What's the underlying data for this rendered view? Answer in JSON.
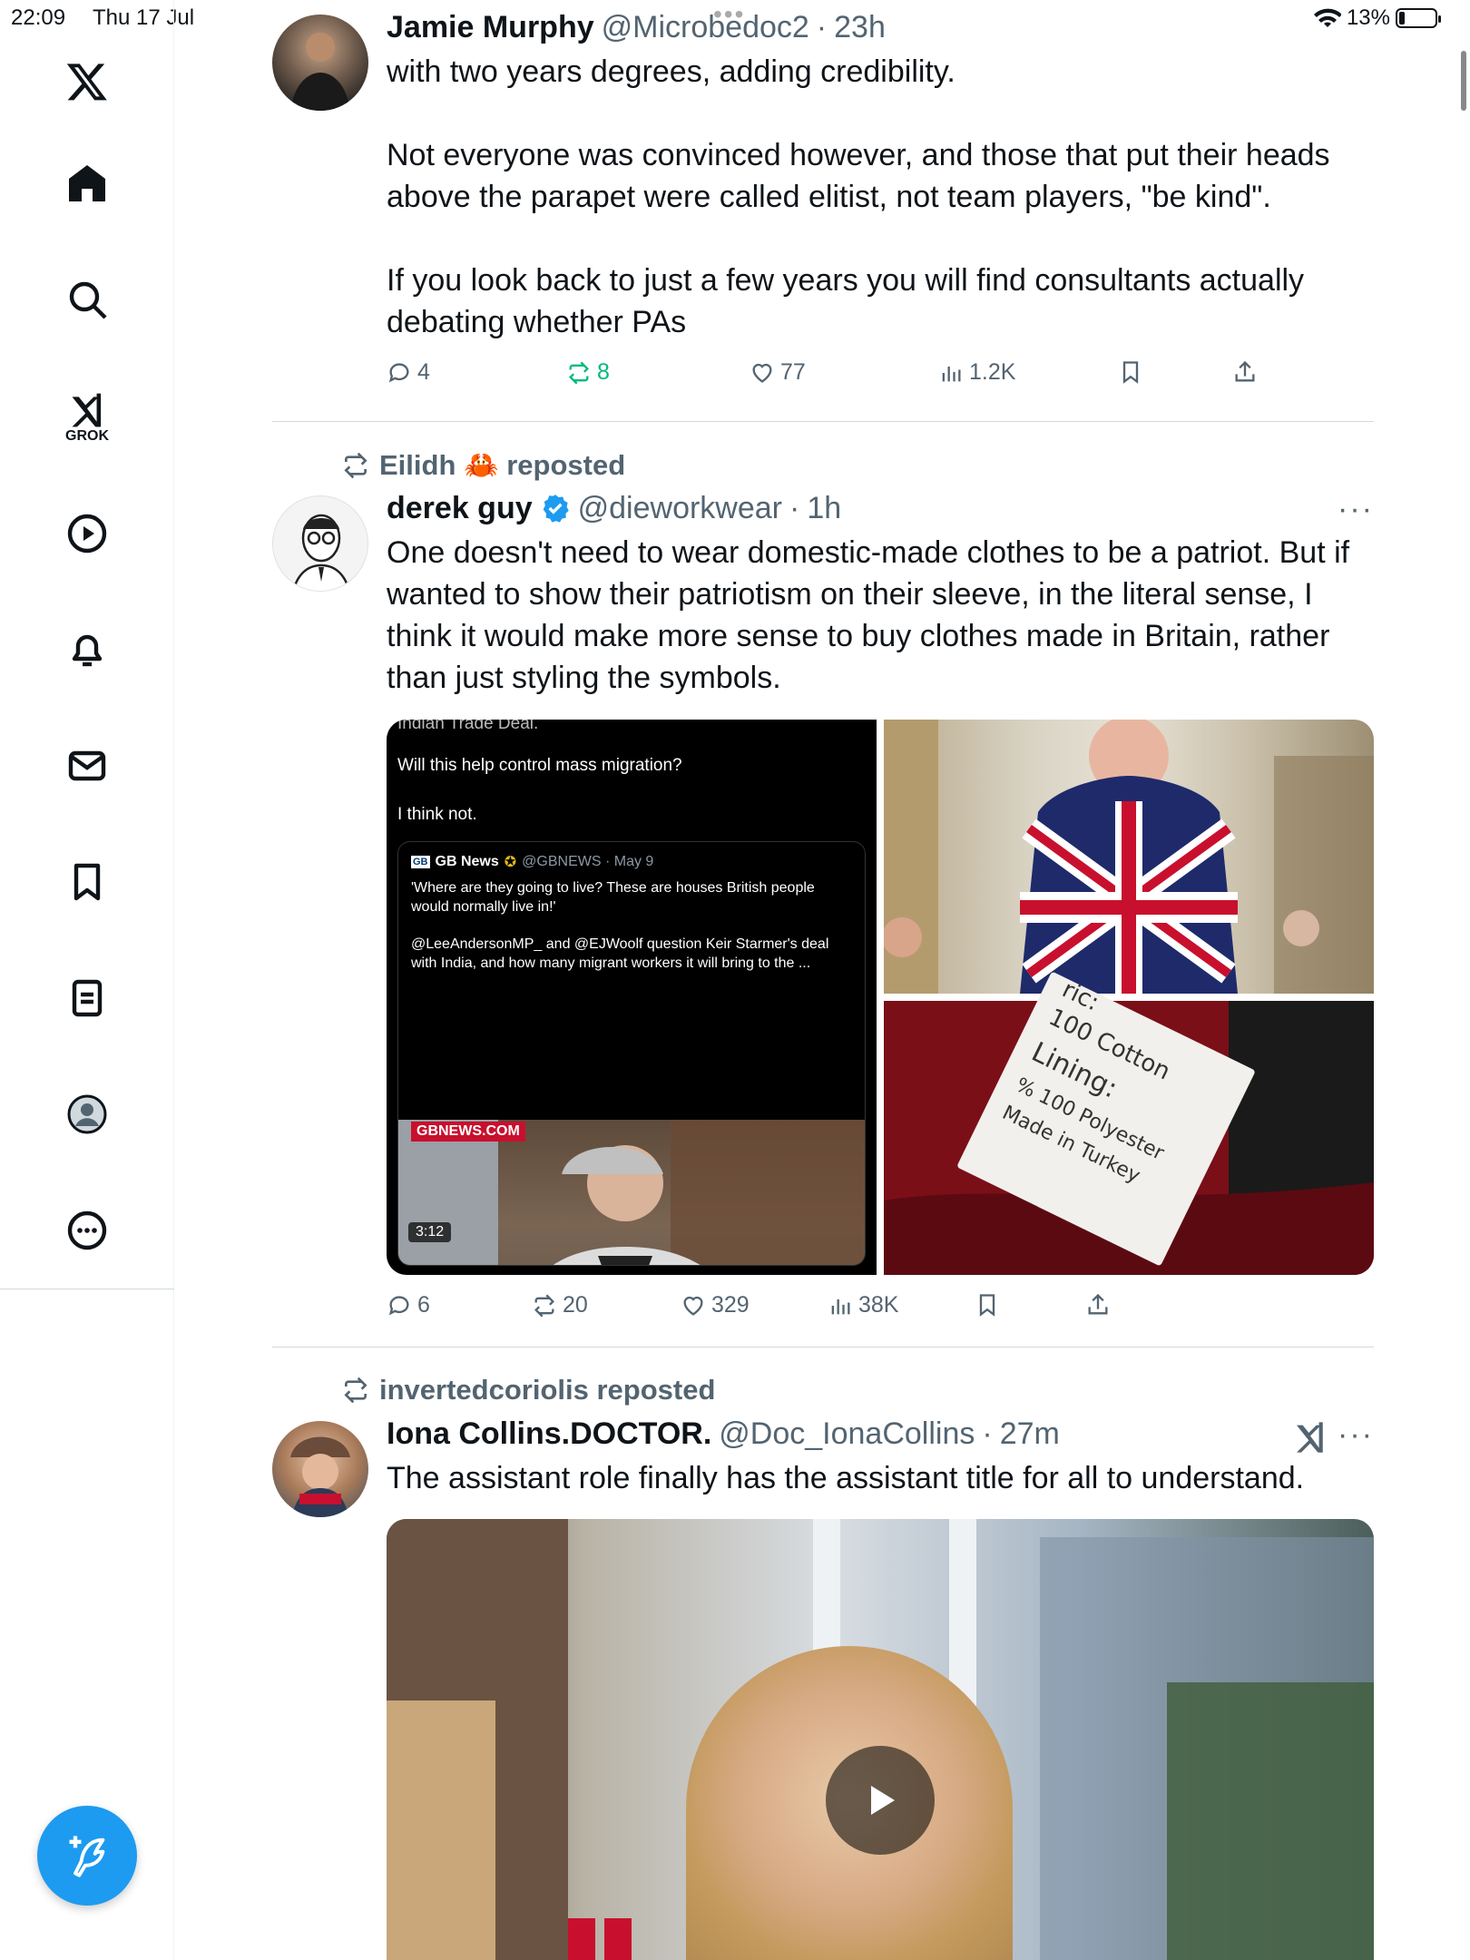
{
  "status_bar": {
    "time": "22:09",
    "date": "Thu 17 Jul",
    "battery": "13%",
    "battery_level": 0.13
  },
  "sidebar": {
    "grok_label": "GROK",
    "items": [
      "home-icon",
      "search-icon",
      "grok-icon",
      "video-icon",
      "notifications-icon",
      "messages-icon",
      "bookmarks-icon",
      "lists-icon",
      "profile-icon",
      "more-icon"
    ]
  },
  "posts": [
    {
      "name": "Jamie Murphy",
      "handle": "@Microbedoc2",
      "dot": "·",
      "time": "23h",
      "text": "with two years degrees, adding credibility.\n\nNot everyone was convinced however, and those that put their heads above the parapet were called elitist, not team players, \"be kind\".\n\nIf you look back to just a few years you will find consultants actually debating whether PAs",
      "replies": "4",
      "reposts": "8",
      "likes": "77",
      "views": "1.2K"
    },
    {
      "reposted_by": "Eilidh 🦀 reposted",
      "name": "derek guy",
      "handle": "@dieworkwear",
      "dot": "·",
      "time": "1h",
      "text": "One doesn't need to wear domestic-made clothes to be a patriot. But if wanted to show their patriotism on their sleeve, in the literal sense, I think it would make more sense to buy clothes made in Britain, rather than just styling the symbols.",
      "replies": "6",
      "reposts": "20",
      "likes": "329",
      "views": "38K",
      "media": {
        "top_text": "Indian Trade Deal.",
        "line1": "Will this help control mass migration?",
        "line2": "I think not.",
        "quote_name": "GB News",
        "quote_handle": "@GBNEWS · May 9",
        "quote_text1": "'Where are they going to live?  These are houses British people would normally live in!'",
        "quote_text2": "@LeeAndersonMP_ and @EJWoolf question Keir Starmer's deal with India, and how many migrant workers it will bring to the ...",
        "source_tag": "GBNEWS.COM",
        "duration": "3:12",
        "label_line1": "ric:",
        "label_line2": "100 Cotton",
        "label_line3": "Lining:",
        "label_line4": "% 100 Polyester",
        "label_line5": "Made in Turkey"
      }
    },
    {
      "reposted_by": "invertedcoriolis reposted",
      "name": "Iona Collins.DOCTOR.",
      "handle": "@Doc_IonaCollins",
      "dot": "·",
      "time": "27m",
      "text": "The assistant role finally has the assistant title for all to understand."
    }
  ],
  "more_label": "···",
  "colors": {
    "accent": "#1d9bf0",
    "repost_green": "#00ba7c",
    "muted": "#536471"
  }
}
